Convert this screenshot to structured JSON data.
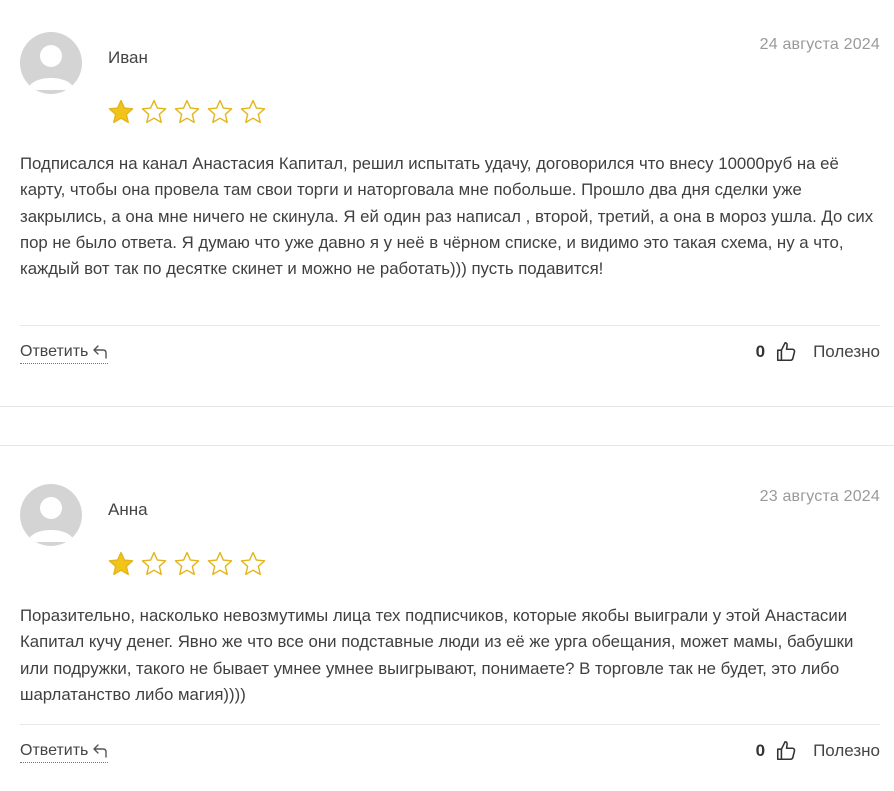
{
  "colors": {
    "star_filled": "#f0c419",
    "star_outline": "#e3b51b",
    "avatar_bg": "#d4d4d4",
    "date_text": "#9a9a9a"
  },
  "reviews": [
    {
      "author": "Иван",
      "date": "24 августа 2024",
      "rating": 1,
      "text": "Подписался на канал Анастасия Капитал, решил испытать удачу, договорился что внесу 10000руб на её карту, чтобы она провела там свои торги и наторговала мне побольше. Прошло два дня сделки уже закрылись, а она мне ничего не скинула. Я ей один раз написал , второй, третий, а она в мороз ушла. До сих пор не было ответа. Я думаю что уже давно я у неё в чёрном списке, и видимо это такая схема, ну а что, каждый вот так по десятке скинет и можно не работать))) пусть подавится!",
      "reply_label": "Ответить",
      "like_count": "0",
      "useful_label": "Полезно"
    },
    {
      "author": "Анна",
      "date": "23 августа 2024",
      "rating": 1,
      "text": "Поразительно, насколько невозмутимы лица тех подписчиков, которые якобы выиграли у этой Анастасии Капитал кучу денег. Явно же что все они подставные люди из её же урга обещания, может мамы, бабушки или подружки, такого не бывает умнее умнее выигрывают, понимаете? В торговле так не будет, это либо шарлатанство либо магия))))",
      "reply_label": "Ответить",
      "like_count": "0",
      "useful_label": "Полезно"
    }
  ]
}
